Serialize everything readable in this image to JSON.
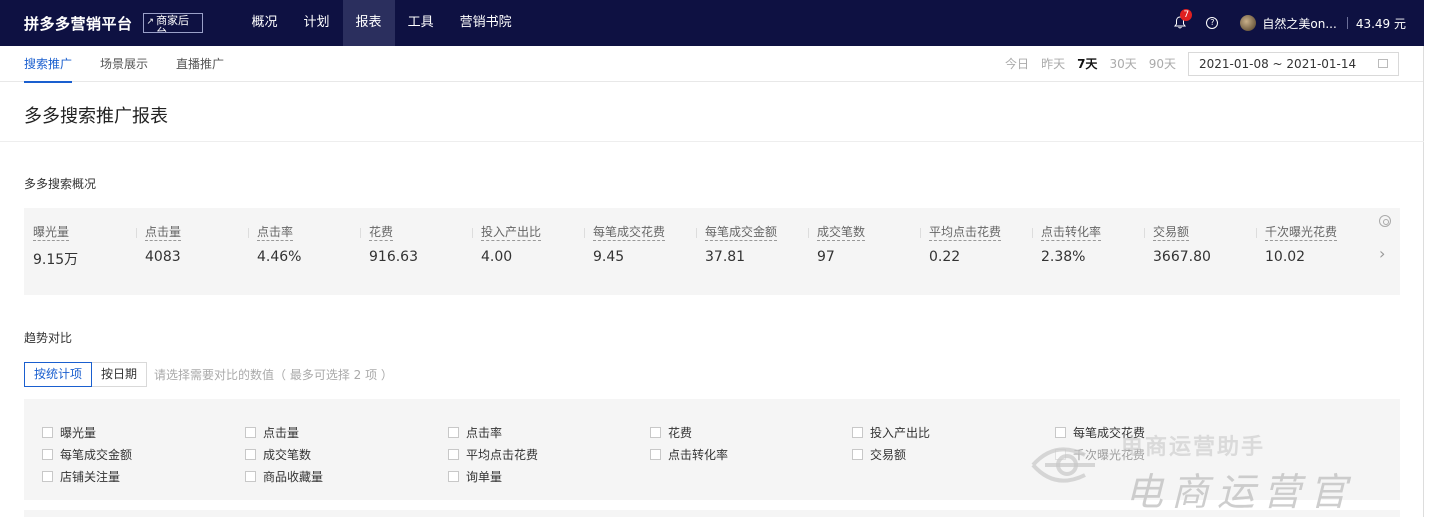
{
  "topbar": {
    "brand": "拼多多营销平台",
    "merchant_link": "商家后台",
    "nav": [
      "概况",
      "计划",
      "报表",
      "工具",
      "营销书院"
    ],
    "active_nav": "报表",
    "notification_count": "7",
    "user_name": "自然之美on...",
    "balance": "43.49 元"
  },
  "subnav": {
    "tabs": [
      "搜索推广",
      "场景展示",
      "直播推广"
    ],
    "active_tab": "搜索推广",
    "ranges": [
      "今日",
      "昨天",
      "7天",
      "30天",
      "90天"
    ],
    "active_range": "7天",
    "date_range": "2021-01-08 ~ 2021-01-14"
  },
  "page": {
    "title": "多多搜索推广报表"
  },
  "overview": {
    "section_title": "多多搜索概况",
    "metrics": [
      {
        "label": "曝光量",
        "value": "9.15万"
      },
      {
        "label": "点击量",
        "value": "4083"
      },
      {
        "label": "点击率",
        "value": "4.46%"
      },
      {
        "label": "花费",
        "value": "916.63"
      },
      {
        "label": "投入产出比",
        "value": "4.00"
      },
      {
        "label": "每笔成交花费",
        "value": "9.45"
      },
      {
        "label": "每笔成交金额",
        "value": "37.81"
      },
      {
        "label": "成交笔数",
        "value": "97"
      },
      {
        "label": "平均点击花费",
        "value": "0.22"
      },
      {
        "label": "点击转化率",
        "value": "2.38%"
      },
      {
        "label": "交易额",
        "value": "3667.80"
      },
      {
        "label": "千次曝光花费",
        "value": "10.02"
      }
    ]
  },
  "trend": {
    "section_title": "趋势对比",
    "tabs": [
      "按统计项",
      "按日期"
    ],
    "active_tab": "按统计项",
    "hint": "请选择需要对比的数值（ 最多可选择 2 项 ）",
    "options": [
      [
        "曝光量",
        "点击量",
        "点击率",
        "花费",
        "投入产出比",
        "每笔成交花费"
      ],
      [
        "每笔成交金额",
        "成交笔数",
        "平均点击花费",
        "点击转化率",
        "交易额",
        "千次曝光花费"
      ],
      [
        "店铺关注量",
        "商品收藏量",
        "询单量"
      ]
    ]
  },
  "watermark": {
    "top": "电商运营助手",
    "main": "电商运营官"
  },
  "colors": {
    "topbar_bg": "#0e1142",
    "accent": "#1a5fcf",
    "badge": "#e02020"
  }
}
